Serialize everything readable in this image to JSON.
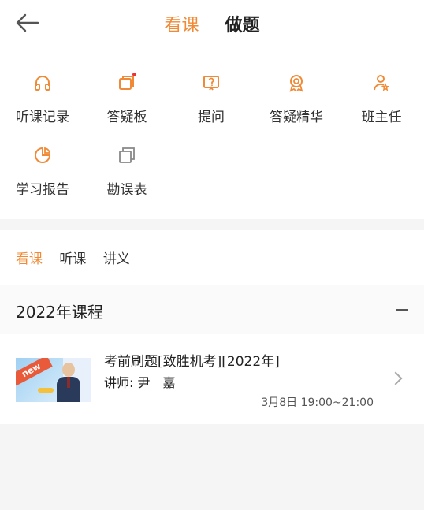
{
  "header": {
    "tabs": [
      {
        "label": "看课",
        "active": true
      },
      {
        "label": "做题",
        "active": false
      }
    ]
  },
  "grid": {
    "items": [
      {
        "label": "听课记录",
        "icon": "headphones-icon"
      },
      {
        "label": "答疑板",
        "icon": "board-icon",
        "has_dot": true
      },
      {
        "label": "提问",
        "icon": "question-icon"
      },
      {
        "label": "答疑精华",
        "icon": "award-icon"
      },
      {
        "label": "班主任",
        "icon": "teacher-icon"
      },
      {
        "label": "学习报告",
        "icon": "report-icon"
      },
      {
        "label": "勘误表",
        "icon": "errata-icon"
      }
    ]
  },
  "subtabs": [
    {
      "label": "看课",
      "active": true
    },
    {
      "label": "听课",
      "active": false
    },
    {
      "label": "讲义",
      "active": false
    }
  ],
  "section": {
    "title": "2022年课程"
  },
  "course": {
    "title": "考前刷题[致胜机考][2022年]",
    "teacher": "讲师: 尹　嘉",
    "time": "3月8日 19:00~21:00",
    "badge": "new"
  },
  "colors": {
    "accent": "#f08a36",
    "dot": "#e33333"
  }
}
